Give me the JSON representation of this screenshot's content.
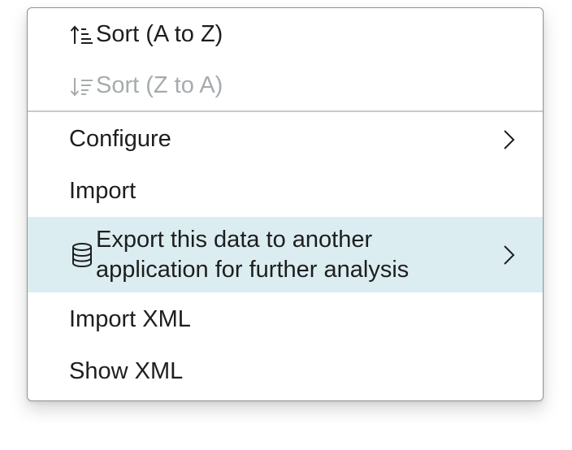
{
  "menu": {
    "items": [
      {
        "label": "Sort (A to Z)",
        "icon": "sort-ascending-icon",
        "disabled": false
      },
      {
        "label": "Sort (Z to A)",
        "icon": "sort-descending-icon",
        "disabled": true
      },
      {
        "label": "Configure",
        "submenu": true
      },
      {
        "label": "Import"
      },
      {
        "label_line1": "Export this data to another",
        "label_line2": "application for further analysis",
        "icon": "database-icon",
        "submenu": true,
        "highlighted": true
      },
      {
        "label": "Import XML"
      },
      {
        "label": "Show XML"
      }
    ]
  },
  "colors": {
    "text": "#1e1e1e",
    "disabled_text": "#a7abad",
    "highlight_bg": "#dcedf2",
    "border": "#8f9497",
    "divider": "#c8cbcd"
  }
}
